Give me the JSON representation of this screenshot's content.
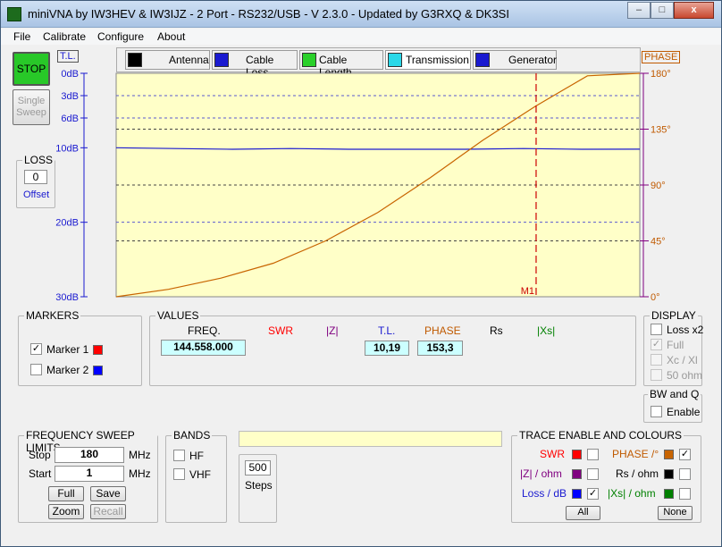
{
  "window": {
    "title": "miniVNA by IW3HEV & IW3IJZ - 2 Port - RS232/USB - V 2.3.0 - Updated by G3RXQ & DK3SI",
    "min": "–",
    "max": "□",
    "close": "x"
  },
  "menu": [
    "File",
    "Calibrate",
    "Configure",
    "About"
  ],
  "left": {
    "stop": "STOP",
    "single": [
      "Single",
      "Sweep"
    ],
    "tl": "T.L.",
    "loss_label": "LOSS",
    "loss_value": "0",
    "offset": "Offset"
  },
  "tabs": [
    {
      "label": "Antenna",
      "icon": "antenna-icon"
    },
    {
      "label": "Cable Loss",
      "icon": "cable-loss-icon"
    },
    {
      "label": "Cable Length",
      "icon": "cable-length-icon"
    },
    {
      "label": "Transmission",
      "icon": "transmission-icon"
    },
    {
      "label": "Generator",
      "icon": "generator-icon"
    }
  ],
  "phase_header": "PHASE",
  "chart_data": {
    "type": "line",
    "x": [
      1,
      180
    ],
    "left_axis": {
      "unit": "dB",
      "ticks": [
        "0dB",
        "3dB",
        "6dB",
        "10dB",
        "20dB",
        "30dB"
      ],
      "values": [
        0,
        3,
        6,
        10,
        20,
        30
      ],
      "range": [
        0,
        30
      ],
      "inverted": true,
      "color": "#1a1ad0"
    },
    "right_axis": {
      "ticks": [
        "180°",
        "135°",
        "90°",
        "45°",
        "0°"
      ],
      "values": [
        180,
        135,
        90,
        45,
        0
      ],
      "range": [
        0,
        180
      ],
      "color": "#c05a00"
    },
    "series": [
      {
        "values_db": [
          10.0,
          10.1,
          10.2,
          10.1,
          10.2,
          10.2,
          10.2,
          10.1,
          10.2,
          10.19
        ],
        "color": "#1a1ad0"
      },
      {
        "values_deg": [
          0,
          6,
          15,
          27,
          45,
          68,
          96,
          126,
          153.3,
          178,
          180
        ],
        "color": "#c86400"
      }
    ],
    "marker": {
      "label": "M1",
      "freq": 144.558,
      "color": "#cc0000"
    },
    "background": "#ffffc8",
    "grid": true
  },
  "markers": {
    "title": "MARKERS",
    "items": [
      {
        "label": "Marker 1",
        "checked": true,
        "color": "#ff0000"
      },
      {
        "label": "Marker 2",
        "checked": false,
        "color": "#0000ff"
      }
    ]
  },
  "values": {
    "title": "VALUES",
    "headers": {
      "freq": "FREQ.",
      "swr": "SWR",
      "z": "|Z|",
      "tl": "T.L.",
      "phase": "PHASE",
      "rs": "Rs",
      "xs": "|Xs|"
    },
    "freq": "144.558.000",
    "tl": "10,19",
    "phase": "153,3"
  },
  "display": {
    "title": "DISPLAY",
    "items": [
      {
        "label": "Loss x2",
        "checked": false,
        "enabled": true
      },
      {
        "label": "Full",
        "checked": true,
        "enabled": false
      },
      {
        "label": "Xc / Xl",
        "checked": false,
        "enabled": false
      },
      {
        "label": "50 ohm",
        "checked": false,
        "enabled": false
      }
    ]
  },
  "bwq": {
    "title": "BW and Q",
    "enable": "Enable"
  },
  "sweep": {
    "title": "FREQUENCY SWEEP LIMITS",
    "stop_label": "Stop",
    "stop_value": "180",
    "start_label": "Start",
    "start_value": "1",
    "unit": "MHz",
    "full": "Full",
    "save": "Save",
    "zoom": "Zoom",
    "recall": "Recall"
  },
  "bands": {
    "title": "BANDS",
    "hf": "HF",
    "vhf": "VHF"
  },
  "steps": {
    "value": "500",
    "label": "Steps"
  },
  "trace": {
    "title": "TRACE ENABLE AND COLOURS",
    "rows": [
      {
        "left": "SWR",
        "lc": "#ff0000",
        "lchk": false,
        "right": "PHASE /°",
        "rc": "#c86400",
        "rchk": true
      },
      {
        "left": "|Z| / ohm",
        "lc": "#800080",
        "lchk": false,
        "right": "Rs / ohm",
        "rc": "#000000",
        "rchk": false
      },
      {
        "left": "Loss / dB",
        "lc": "#0000ff",
        "lchk": true,
        "right": "|Xs| / ohm",
        "rc": "#008000",
        "rchk": false
      }
    ],
    "all": "All",
    "none": "None"
  }
}
